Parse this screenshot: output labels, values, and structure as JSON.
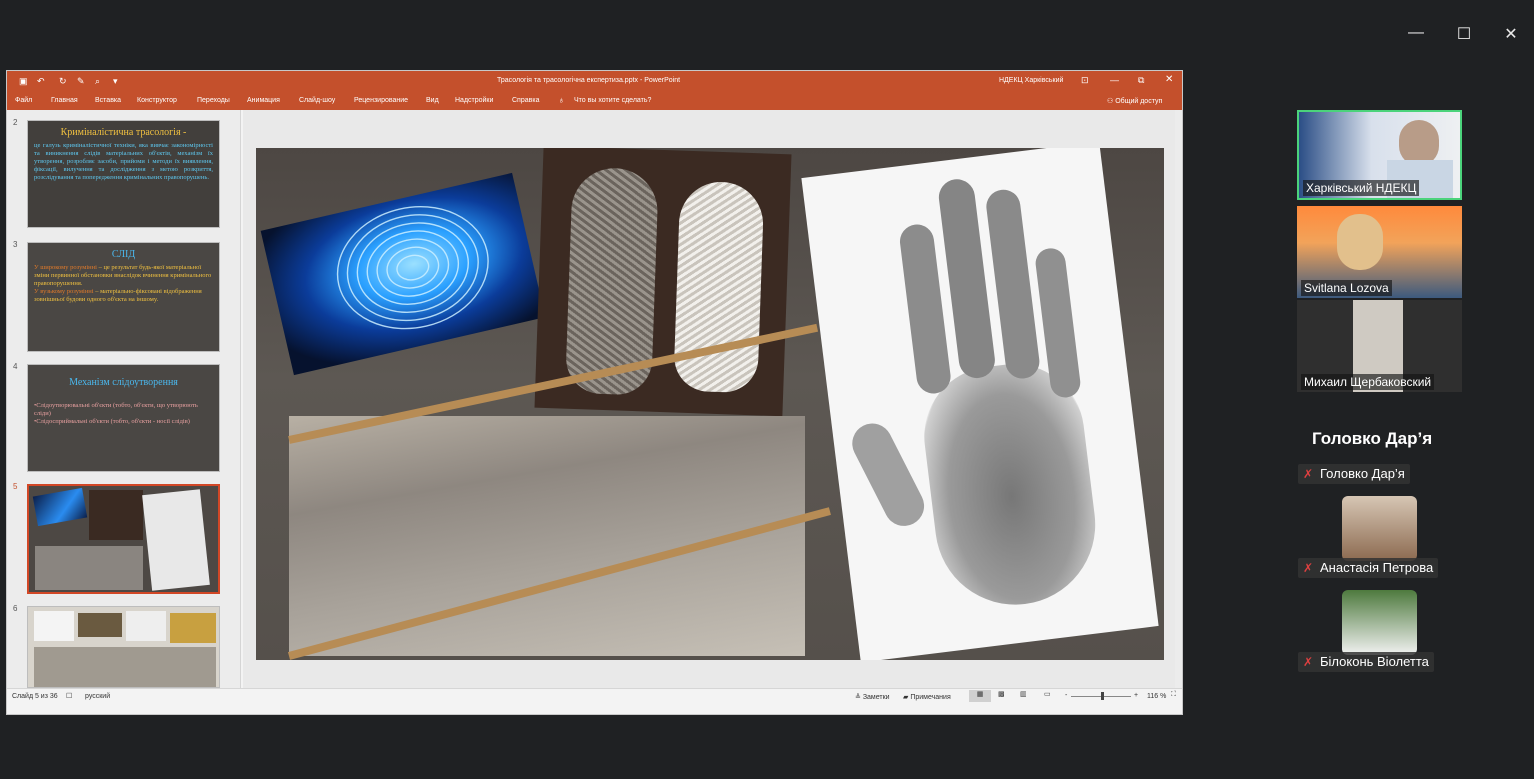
{
  "window": {
    "minimize_icon": "minimize-icon",
    "maximize_icon": "maximize-icon",
    "close_icon": "close-icon",
    "min_glyph": "—",
    "max_glyph": "☐",
    "close_glyph": "✕"
  },
  "powerpoint": {
    "title": "Трасологія та трасологічна експертиза.pptx - PowerPoint",
    "account": "НДЕКЦ Харківський",
    "quick_access": [
      "save-icon",
      "undo-icon",
      "redo-icon",
      "format-icon",
      "preview-icon",
      "customize-icon"
    ],
    "ribbon_tabs": [
      "Файл",
      "Главная",
      "Вставка",
      "Конструктор",
      "Переходы",
      "Анимация",
      "Слайд-шоу",
      "Рецензирование",
      "Вид",
      "Надстройки",
      "Справка"
    ],
    "tell_me": "Что вы хотите сделать?",
    "share": "Общий доступ",
    "thumbnails": [
      {
        "number": "2",
        "title": "Криміналістична трасологія -",
        "body": "це галузь криміналістичної техніки, яка вивчає закономірності та виникнення слідів матеріальних об'єктів, механізм їх утворення, розробляє засоби, прийоми і методи їх виявлення, фіксації, вилучення та дослідження з метою розкриття, розслідування та попередження кримінальних правопорушень."
      },
      {
        "number": "3",
        "title": "СЛІД",
        "body_a_label": "У широкому розумінні",
        "body_a": " – це результат будь-якої матеріальної зміни первинної обстановки внаслідок вчинення кримінального правопорушення.",
        "body_b_label": "У вузькому розумінні",
        "body_b": " – матеріально-фіксовані відображення зовнішньої будови одного об'єкта на іншому."
      },
      {
        "number": "4",
        "title": "Механізм слідоутворення",
        "bullet_1": "•Слідоутворювальні об'єкти (тобто, об'єкти, що утворюють сліди)",
        "bullet_2": "•Слідосприймальні об'єкти (тобто, об'єкти - носії слідів)"
      },
      {
        "number": "5"
      },
      {
        "number": "6"
      }
    ],
    "status": {
      "slide_counter": "Слайд 5 из 36",
      "language": "русский",
      "notes": "Заметки",
      "comments": "Примечания",
      "zoom_minus": "-",
      "zoom_plus": "+",
      "zoom": "116 %"
    }
  },
  "participants": [
    {
      "name": "Харківський НДЕКЦ",
      "active": true,
      "accent": "#4bd37b"
    },
    {
      "name": "Svitlana Lozova"
    },
    {
      "name": "Михаил Щербаковский"
    }
  ],
  "speaker_heading": "Головко Дар’я",
  "audio_participants": [
    {
      "name": "Головко Дар’я",
      "muted": true
    },
    {
      "name": "Анастасія Петрова",
      "muted": true
    },
    {
      "name": "Білоконь Віолетта",
      "muted": true
    }
  ],
  "colors": {
    "ribbon": "#c4502c",
    "mic_muted": "#e04040",
    "active_border": "#4bd37b"
  }
}
